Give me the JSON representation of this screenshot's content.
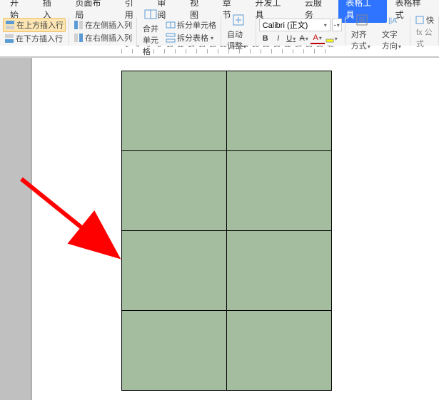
{
  "tabs": {
    "start": "开始",
    "insert": "插入",
    "layout": "页面布局",
    "refs": "引用",
    "review": "审阅",
    "view": "视图",
    "section": "章节",
    "dev": "开发工具",
    "cloud": "云服务",
    "table_tools": "表格工具",
    "table_style": "表格样式"
  },
  "ribbon": {
    "insert_row_above": "在上方插入行",
    "insert_row_below": "在下方插入行",
    "insert_col_left": "在左侧插入列",
    "insert_col_right": "在右侧插入列",
    "merge_cells": "合并单元格",
    "split_cells": "拆分单元格",
    "split_table": "拆分表格",
    "auto_fit": "自动调整",
    "font_name": "Calibri (正文)",
    "bold": "B",
    "italic": "I",
    "underline": "U",
    "strike": "A",
    "font_color": "A",
    "align": "对齐方式",
    "text_direction": "文字方向",
    "fast": "快",
    "fx": "fx 公式"
  },
  "ruler": [
    "2",
    "4",
    "6",
    "8",
    "10",
    "12",
    "14",
    "16",
    "18",
    "20",
    "2",
    "24",
    "26",
    "28",
    "30",
    "32",
    "34",
    "36",
    "38",
    "40"
  ],
  "table": {
    "rows": 4,
    "cols": 2,
    "fill": "#a3bd9e"
  }
}
